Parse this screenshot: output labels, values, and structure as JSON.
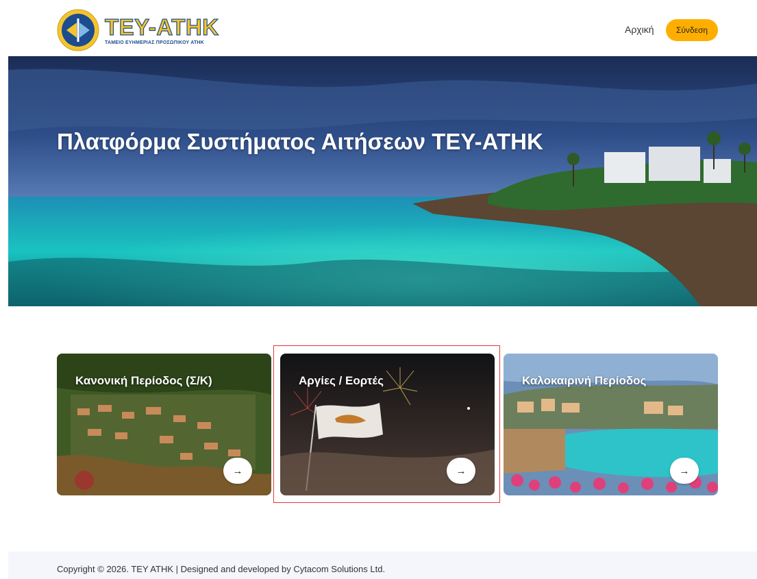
{
  "header": {
    "logo_name": "TEY-ATHK",
    "logo_subtitle": "ΤΑΜΕΙΟ ΕΥΗΜΕΡΙΑΣ ΠΡΟΣΩΠΙΚΟΥ ΑΤΗΚ",
    "nav_home": "Αρχική",
    "login_label": "Σύνδεση",
    "accent_color": "#ffae00"
  },
  "hero": {
    "title": "Πλατφόρμα Συστήματος Αιτήσεων TEY-ATHK"
  },
  "cards": [
    {
      "title": "Κανονική Περίοδος (Σ/Κ)",
      "arrow_icon": "arrow-right-icon"
    },
    {
      "title": "Αργίες / Εορτές",
      "arrow_icon": "arrow-right-icon",
      "selected": true
    },
    {
      "title": "Καλοκαιρινή Περίοδος",
      "arrow_icon": "arrow-right-icon"
    }
  ],
  "footer": {
    "copyright": "Copyright © 2026. TEY ATHK | Designed and developed by Cytacom Solutions Ltd."
  }
}
